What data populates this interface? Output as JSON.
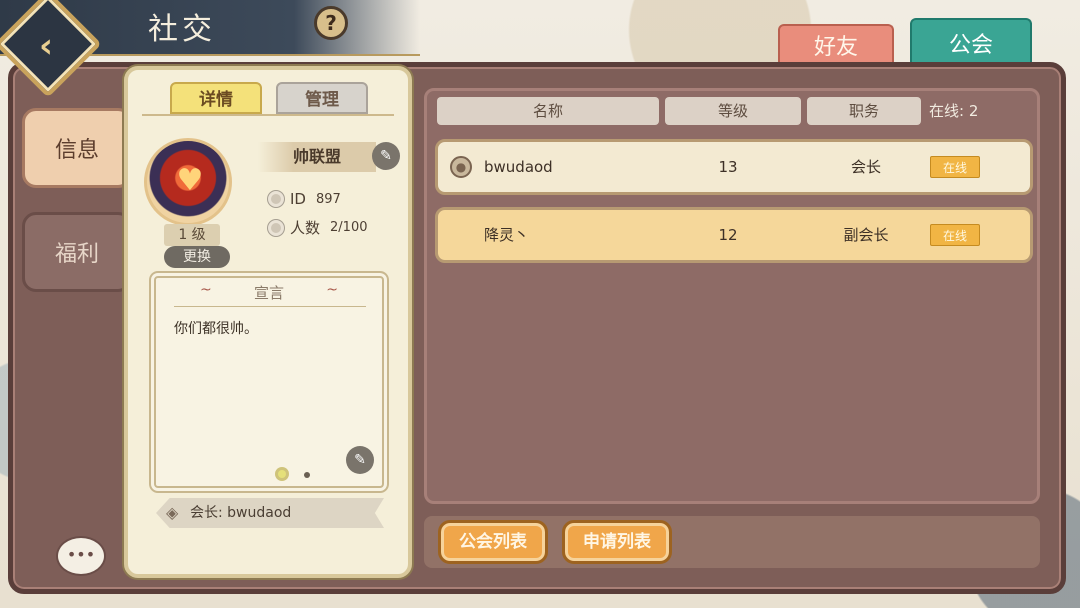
{
  "header": {
    "title": "社交",
    "help_label": "?"
  },
  "top_tabs": {
    "friend": "好友",
    "guild": "公会"
  },
  "side_tabs": {
    "info": "信息",
    "benefit": "福利"
  },
  "detail": {
    "tabs": {
      "details": "详情",
      "manage": "管理"
    },
    "guild_name": "帅联盟",
    "guild_level": "1 级",
    "change_label": "更换",
    "id_label": "ID",
    "id_value": "897",
    "members_label": "人数",
    "members_value": "2/100",
    "declaration_title": "宣言",
    "declaration_text": "你们都很帅。",
    "leader_label": "会长:",
    "leader_name": "bwudaod"
  },
  "members": {
    "headers": {
      "name": "名称",
      "level": "等级",
      "role": "职务"
    },
    "online_label": "在线: 2",
    "rows": [
      {
        "name": "bwudaod",
        "level": "13",
        "role": "会长",
        "status": "在线"
      },
      {
        "name": "降灵丶",
        "level": "12",
        "role": "副会长",
        "status": "在线"
      }
    ]
  },
  "buttons": {
    "guild_list": "公会列表",
    "apply_list": "申请列表"
  },
  "colors": {
    "frame": "#7e5e58",
    "friend_tab": "#e98d7c",
    "guild_tab": "#3aa594",
    "online_badge": "#f1b544",
    "button": "#f0a64a"
  }
}
